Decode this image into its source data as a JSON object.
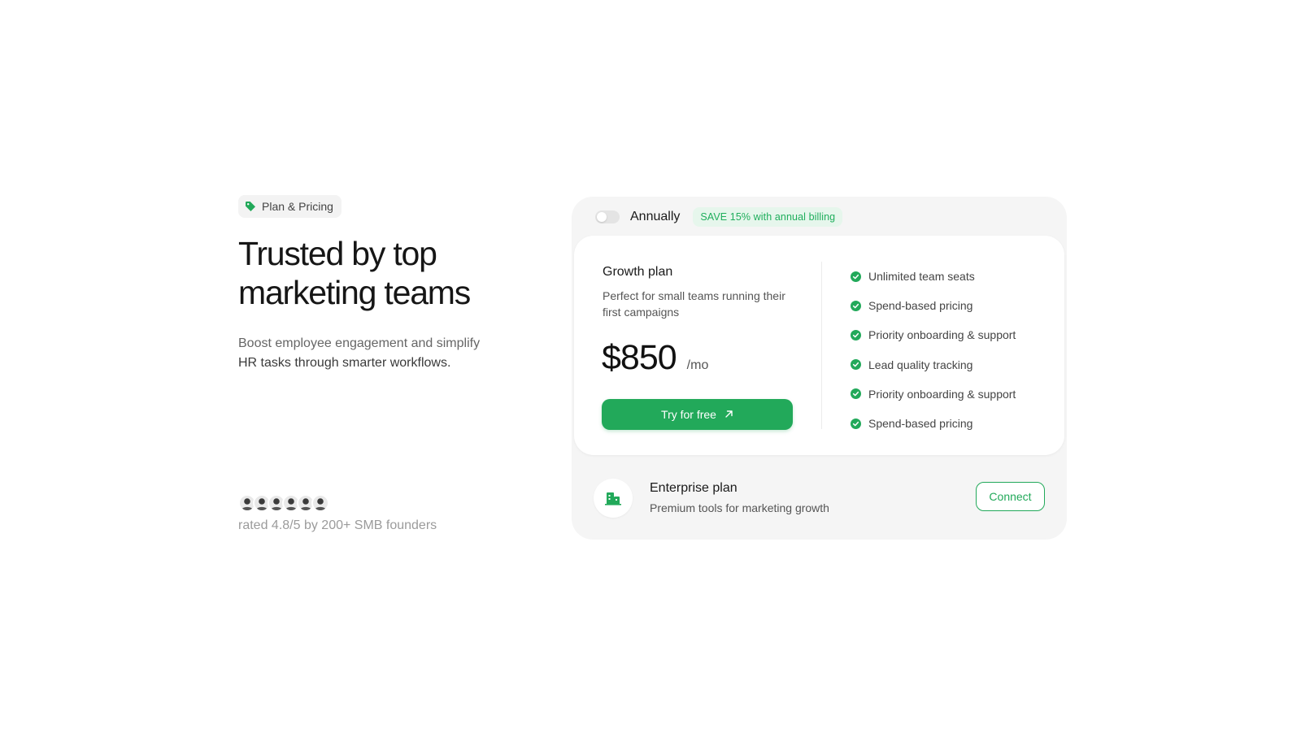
{
  "colors": {
    "accent": "#22a95a",
    "accent_soft": "#e6f6ec",
    "panel_bg": "#f5f5f5"
  },
  "hero": {
    "tag_icon": "price-tag-icon",
    "tag_label": "Plan & Pricing",
    "headline": "Trusted by top marketing teams",
    "subtext_line1": "Boost employee engagement and simplify",
    "subtext_line2": "HR tasks through smarter workflows."
  },
  "social_proof": {
    "avatar_count": 6,
    "rating_text": "rated 4.8/5 by 200+ SMB founders"
  },
  "billing": {
    "toggle_on": false,
    "label": "Annually",
    "save_badge": "SAVE 15% with annual billing"
  },
  "growth_plan": {
    "name": "Growth plan",
    "description": "Perfect for small teams running their first campaigns",
    "price": "$850",
    "period": "/mo",
    "cta_label": "Try for free",
    "cta_icon": "arrow-up-right-icon",
    "features": [
      "Unlimited team seats",
      "Spend-based pricing",
      "Priority onboarding & support",
      "Lead quality tracking",
      "Priority onboarding & support",
      "Spend-based pricing"
    ]
  },
  "enterprise_plan": {
    "icon": "building-icon",
    "name": "Enterprise plan",
    "description": "Premium tools for marketing growth",
    "cta_label": "Connect"
  }
}
